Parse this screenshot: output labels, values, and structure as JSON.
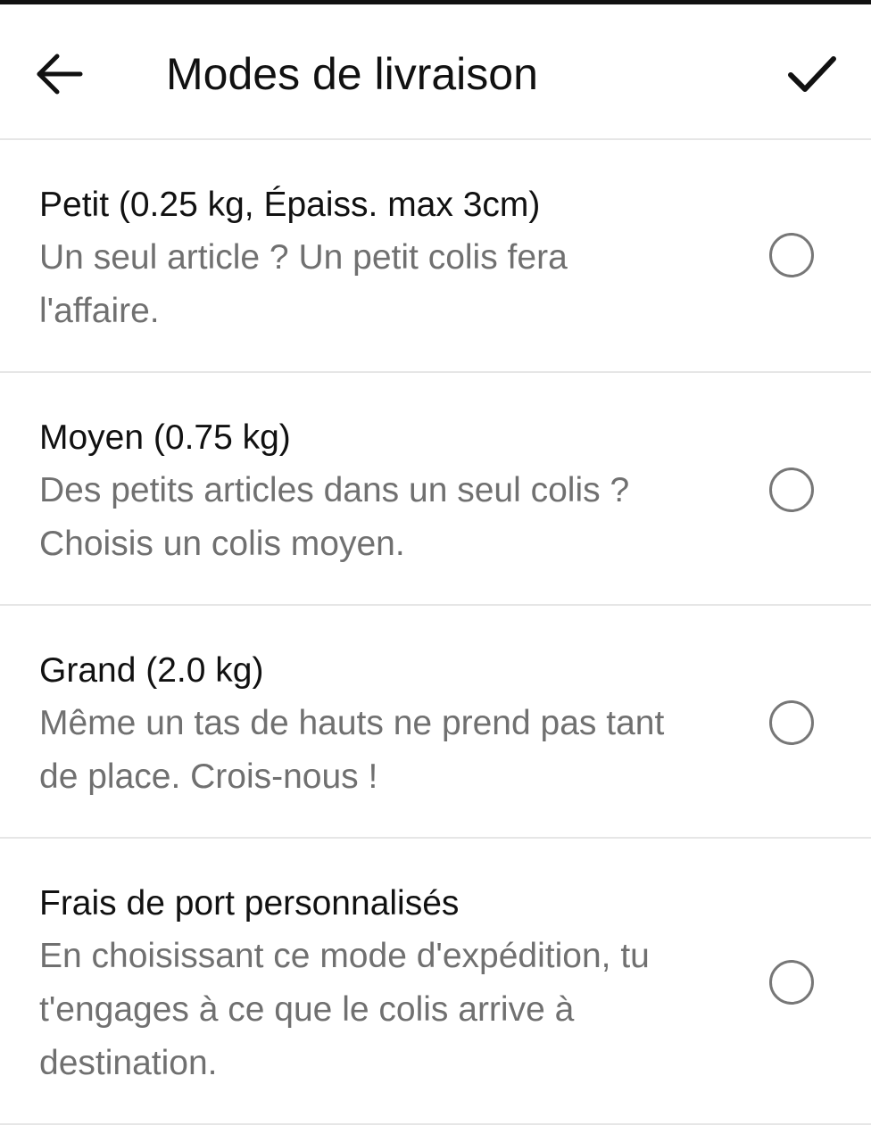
{
  "header": {
    "title": "Modes de livraison"
  },
  "icons": {
    "back": "arrow-left-icon",
    "confirm": "checkmark-icon"
  },
  "options": [
    {
      "name": "Petit (0.25 kg, Épaiss. max 3cm)",
      "description": "Un seul article ? Un petit colis fera l'affaire.",
      "selected": false
    },
    {
      "name": "Moyen (0.75 kg)",
      "description": "Des petits articles dans un seul colis ? Choisis un colis moyen.",
      "selected": false
    },
    {
      "name": "Grand (2.0 kg)",
      "description": "Même un tas de hauts ne prend pas tant de place. Crois-nous !",
      "selected": false
    },
    {
      "name": "Frais de port personnalisés",
      "description": "En choisissant ce mode d'expédition, tu t'engages à ce que le colis arrive à destination.",
      "selected": false
    }
  ],
  "colors": {
    "text_primary": "#111111",
    "text_secondary": "#707070",
    "divider": "#e6e6e6",
    "radio_border": "#777777"
  }
}
